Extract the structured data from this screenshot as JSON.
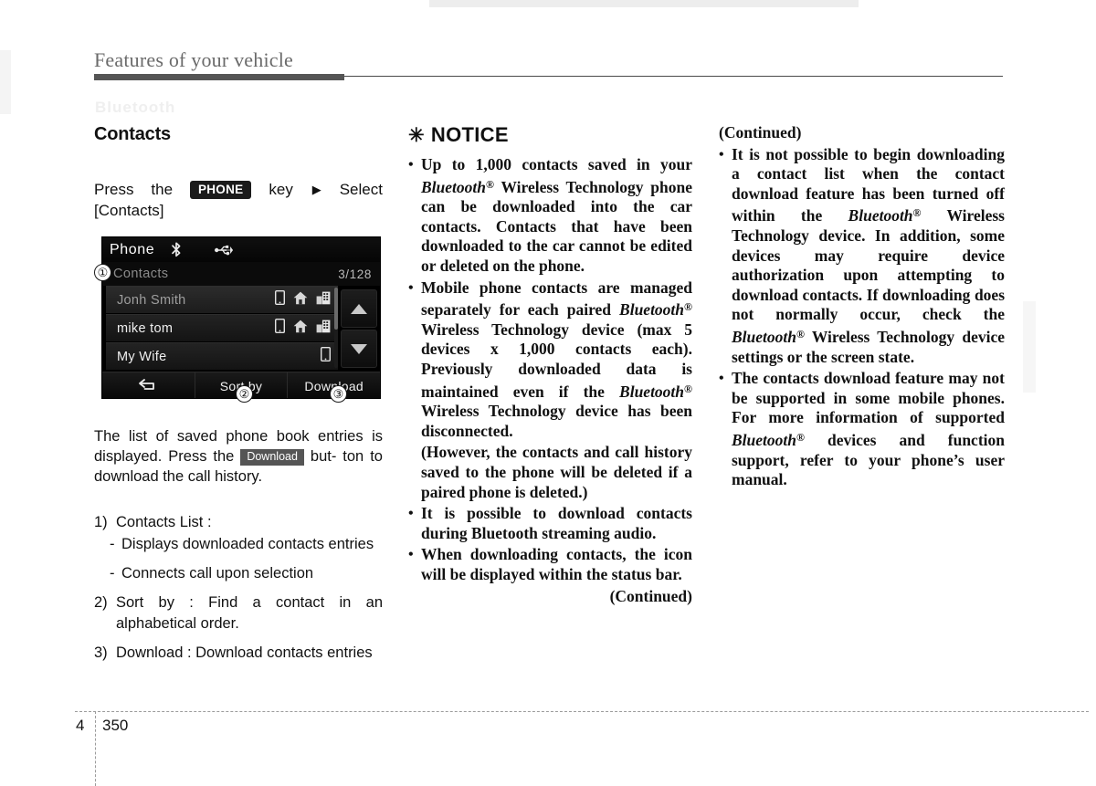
{
  "page": {
    "header_title": "Features of your vehicle",
    "ghost_watermark": "Bluetooth",
    "footer_chapter": "4",
    "footer_page": "350"
  },
  "left_column": {
    "section_title": "Contacts",
    "press_line": {
      "word_press": "Press",
      "word_the": "the",
      "key_chip": "PHONE",
      "word_key": "key",
      "arrow": "▶",
      "word_select": "Select",
      "line2": "[Contacts]"
    },
    "device": {
      "app_title": "Phone",
      "bluetooth_icon": "bluetooth-icon",
      "usb_icon": "usb-icon",
      "subbar_label": "Contacts",
      "count": "3/128",
      "rows": [
        {
          "name": "Jonh Smith",
          "selected": true,
          "icons": [
            "mobile-icon",
            "home-icon",
            "office-icon"
          ]
        },
        {
          "name": "mike tom",
          "selected": false,
          "icons": [
            "mobile-icon",
            "home-icon",
            "office-icon"
          ]
        },
        {
          "name": "My Wife",
          "selected": false,
          "icons": [
            "mobile-icon"
          ]
        }
      ],
      "scroll_up": "scroll-up-icon",
      "scroll_down": "scroll-down-icon",
      "toolbar": {
        "back": "back-icon",
        "sort_by": "Sort by",
        "download": "Download"
      }
    },
    "callouts": {
      "one": "①",
      "two": "②",
      "three": "③"
    },
    "body_paragraph": {
      "part1": "The list of saved phone book entries is displayed. Press the",
      "chip": "Download",
      "part2": "but-",
      "part3": "ton to download the call history."
    },
    "numbered_items": [
      {
        "num": "1)",
        "text": "Contacts List :",
        "subitems": [
          {
            "dash": "-",
            "text": "Displays downloaded contacts entries"
          },
          {
            "dash": "-",
            "text": "Connects call upon selection"
          }
        ]
      },
      {
        "num": "2)",
        "text": "Sort by : Find a contact in an alphabetical order.",
        "subitems": []
      },
      {
        "num": "3)",
        "text": "Download : Download contacts entries",
        "subitems": []
      }
    ]
  },
  "middle_column": {
    "notice_star": "✳",
    "notice_title": "NOTICE",
    "bullets": [
      {
        "mark": "•",
        "segments": [
          {
            "t": "Up to 1,000 contacts saved in your "
          },
          {
            "t": "Bluetooth",
            "style": "italic"
          },
          {
            "t": "®",
            "style": "sup"
          },
          {
            "t": " Wireless Technology phone can be downloaded into the car contacts. Contacts that have been downloaded to the car cannot be edited or deleted on the phone."
          }
        ]
      },
      {
        "mark": "•",
        "segments": [
          {
            "t": "Mobile phone contacts are managed separately for each paired "
          },
          {
            "t": "Bluetooth",
            "style": "italic"
          },
          {
            "t": "®",
            "style": "sup"
          },
          {
            "t": " Wireless Technology device (max 5 devices x 1,000 contacts each). Previously downloaded data is maintained even if the "
          },
          {
            "t": "Bluetooth",
            "style": "italic"
          },
          {
            "t": "®",
            "style": "sup"
          },
          {
            "t": " Wireless Technology device has been disconnected."
          }
        ]
      },
      {
        "mark": "",
        "segments": [
          {
            "t": "(However, the contacts and call history saved to the phone will be deleted if a paired phone is deleted.)"
          }
        ]
      },
      {
        "mark": "•",
        "segments": [
          {
            "t": "It is possible to download contacts during Bluetooth streaming audio."
          }
        ]
      },
      {
        "mark": "•",
        "segments": [
          {
            "t": "When downloading contacts, the icon will be displayed within the status bar."
          }
        ]
      }
    ],
    "continued": "(Continued)"
  },
  "right_column": {
    "continued_head": "(Continued)",
    "bullets": [
      {
        "mark": "•",
        "segments": [
          {
            "t": "It is not possible to begin downloading a contact list when the contact download feature has been turned off within the "
          },
          {
            "t": "Bluetooth",
            "style": "italic"
          },
          {
            "t": "®",
            "style": "sup"
          },
          {
            "t": " Wireless Technology device. In addition, some devices may require device authorization upon attempting to download contacts. If downloading does not normally occur, check the "
          },
          {
            "t": "Bluetooth",
            "style": "italic"
          },
          {
            "t": "®",
            "style": "sup"
          },
          {
            "t": " Wireless Technology device settings or the screen state."
          }
        ]
      },
      {
        "mark": "•",
        "segments": [
          {
            "t": "The contacts download feature may not be supported in some mobile phones. For more information of supported "
          },
          {
            "t": "Bluetooth",
            "style": "italic"
          },
          {
            "t": "®",
            "style": "sup"
          },
          {
            "t": " devices and function support, refer to your phone’s user manual."
          }
        ]
      }
    ]
  }
}
